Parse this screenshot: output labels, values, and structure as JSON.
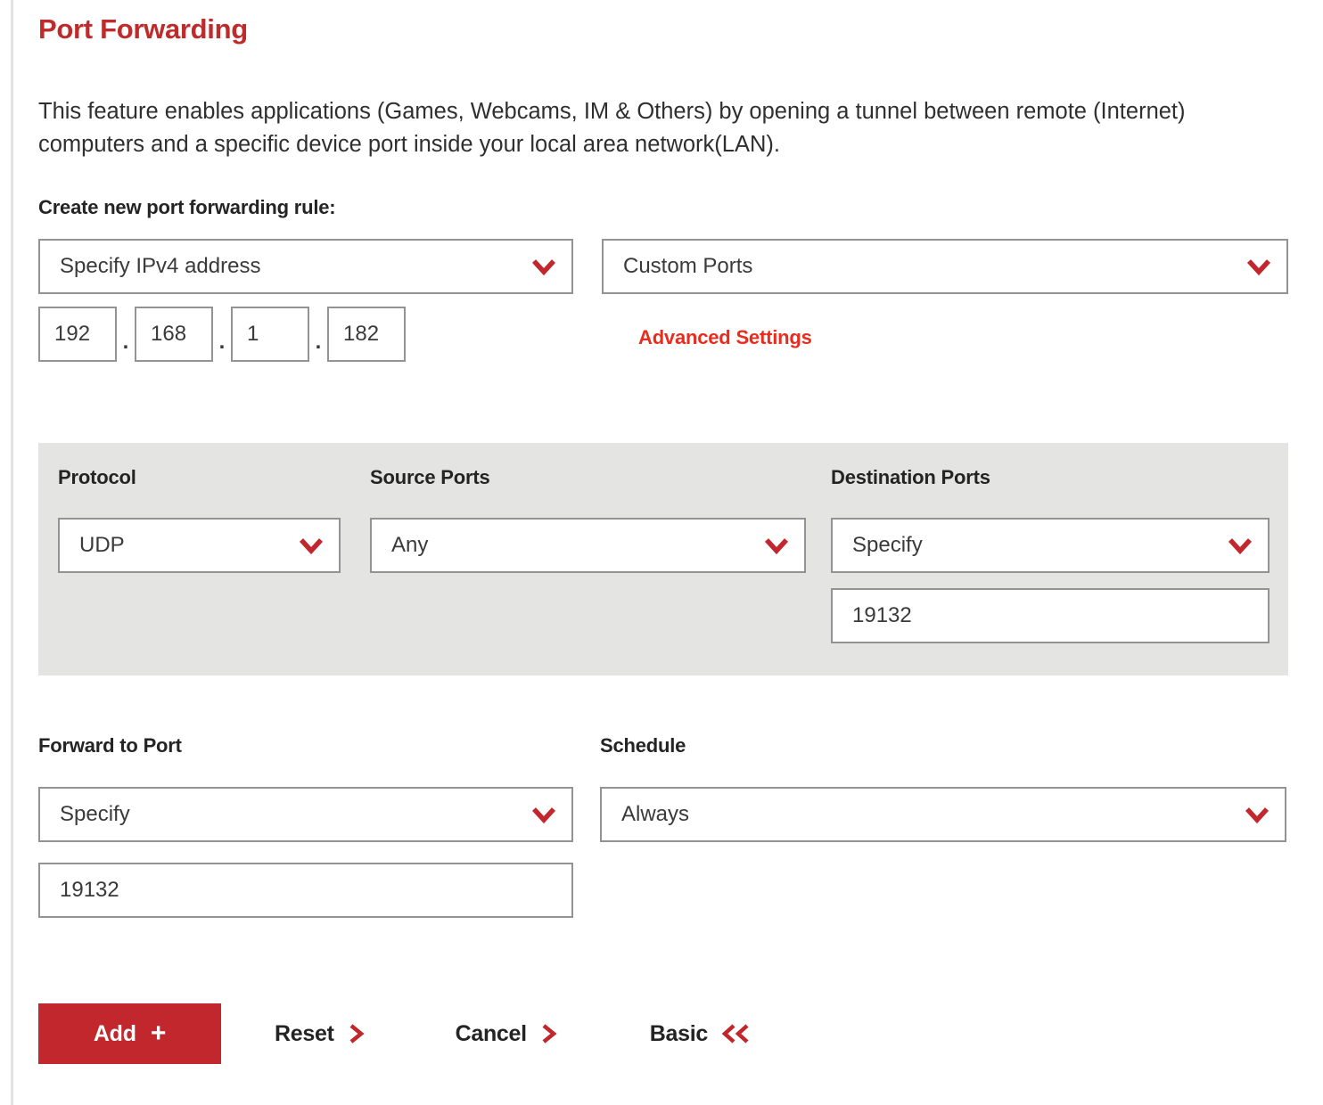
{
  "page": {
    "title": "Port Forwarding",
    "intro": "This feature enables applications (Games, Webcams, IM & Others) by opening a tunnel between remote (Internet) computers and a specific device port inside your local area network(LAN).",
    "create_label": "Create new port forwarding rule:"
  },
  "colors": {
    "title_red": "#bf2a2a",
    "link_red": "#e82c1e",
    "chevron_red": "#c1272d",
    "add_button_red": "#c1272d",
    "panel_gray": "#e4e4e3",
    "field_border": "#939393",
    "text_dark": "#242424"
  },
  "rule_form": {
    "device": {
      "label": "",
      "value": "Specify IPv4 address",
      "icon": "chevron-down-icon"
    },
    "ports_mode": {
      "value": "Custom Ports",
      "icon": "chevron-down-icon"
    },
    "ip_address": {
      "octets": [
        "192",
        "168",
        "1",
        "182"
      ],
      "separator": "."
    },
    "advanced_settings_link": "Advanced Settings"
  },
  "advanced": {
    "protocol": {
      "label": "Protocol",
      "value": "UDP",
      "icon": "chevron-down-icon"
    },
    "source_ports": {
      "label": "Source Ports",
      "value": "Any",
      "icon": "chevron-down-icon"
    },
    "destination_ports": {
      "label": "Destination Ports",
      "value": "Specify",
      "icon": "chevron-down-icon",
      "port": "19132"
    }
  },
  "forward": {
    "label": "Forward to Port",
    "value": "Specify",
    "icon": "chevron-down-icon",
    "port": "19132"
  },
  "schedule": {
    "label": "Schedule",
    "value": "Always",
    "icon": "chevron-down-icon"
  },
  "actions": {
    "add": {
      "label": "Add",
      "glyph": "+",
      "icon": "plus-icon"
    },
    "reset": {
      "label": "Reset",
      "icon": "chevron-right-icon"
    },
    "cancel": {
      "label": "Cancel",
      "icon": "chevron-right-icon"
    },
    "basic": {
      "label": "Basic",
      "icon": "chevron-double-left-icon"
    }
  }
}
